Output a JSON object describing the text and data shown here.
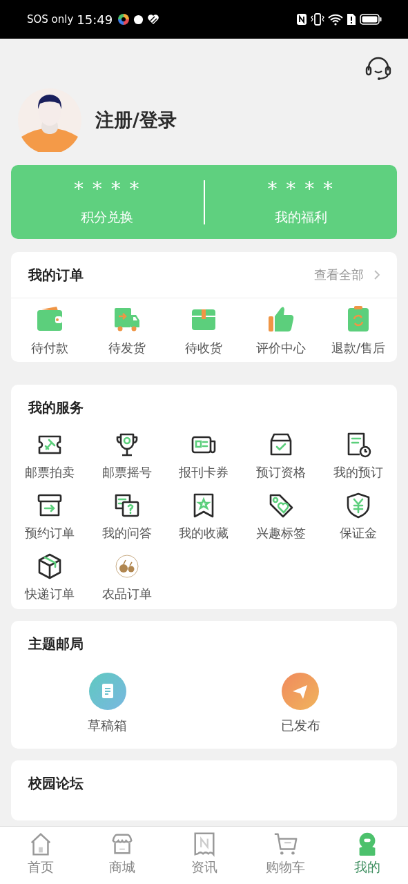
{
  "status_bar": {
    "carrier": "SOS only",
    "time": "15:49"
  },
  "profile": {
    "login": "注册/登录"
  },
  "stats": [
    {
      "value": "* * * *",
      "label": "积分兑换"
    },
    {
      "value": "* * * *",
      "label": "我的福利"
    }
  ],
  "orders": {
    "title": "我的订单",
    "view_all": "查看全部",
    "items": [
      "待付款",
      "待发货",
      "待收货",
      "评价中心",
      "退款/售后"
    ]
  },
  "services": {
    "title": "我的服务",
    "items": [
      "邮票拍卖",
      "邮票摇号",
      "报刊卡券",
      "预订资格",
      "我的预订",
      "预约订单",
      "我的问答",
      "我的收藏",
      "兴趣标签",
      "保证金",
      "快递订单",
      "农品订单"
    ]
  },
  "theme_post_office": {
    "title": "主题邮局",
    "items": [
      "草稿箱",
      "已发布"
    ]
  },
  "forum": {
    "title": "校园论坛"
  },
  "tab_bar": [
    {
      "label": "首页",
      "selected": false
    },
    {
      "label": "商城",
      "selected": false
    },
    {
      "label": "资讯",
      "selected": false
    },
    {
      "label": "购物车",
      "selected": false
    },
    {
      "label": "我的",
      "selected": true
    }
  ]
}
